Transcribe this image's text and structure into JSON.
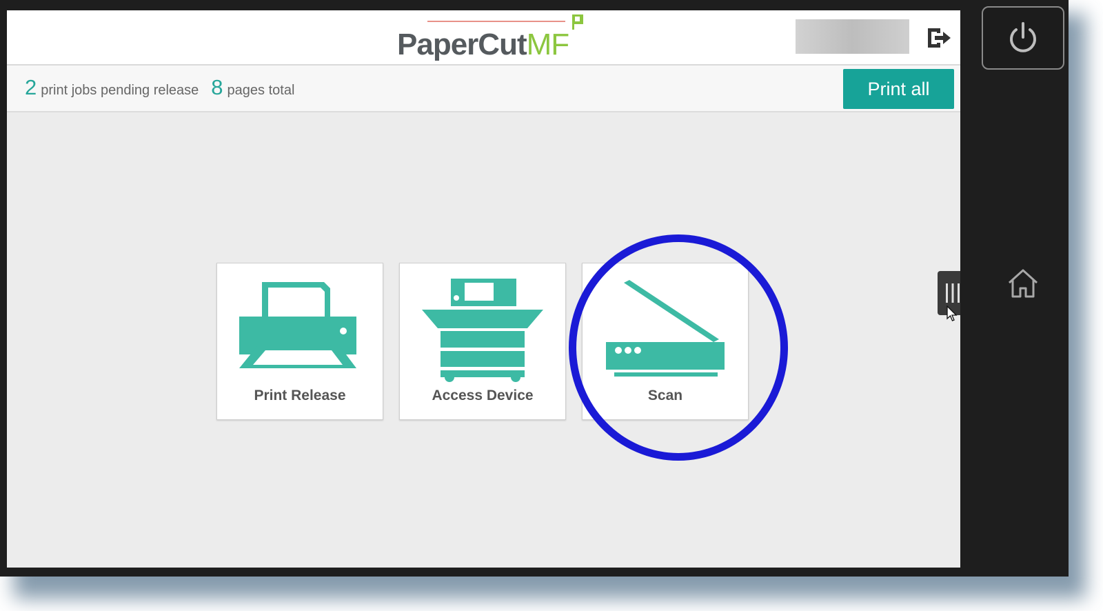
{
  "header": {
    "logo_primary": "PaperCut",
    "logo_suffix": "MF",
    "logout_icon": "logout-icon"
  },
  "status": {
    "jobs_count": "2",
    "jobs_label": "print jobs pending release",
    "pages_count": "8",
    "pages_label": "pages total",
    "print_all_label": "Print all"
  },
  "tiles": [
    {
      "label": "Print Release",
      "icon": "printer-icon"
    },
    {
      "label": "Access Device",
      "icon": "copier-icon"
    },
    {
      "label": "Scan",
      "icon": "scanner-icon"
    }
  ],
  "device": {
    "power_icon": "power-icon",
    "home_icon": "home-icon",
    "side_menu_icon": "menu-bars-icon"
  },
  "colors": {
    "accent": "#17a398",
    "icon_teal": "#3dbaa4",
    "highlight_ring": "#1a1ad6",
    "logo_gray": "#555a5e",
    "logo_green": "#8cc63f"
  }
}
